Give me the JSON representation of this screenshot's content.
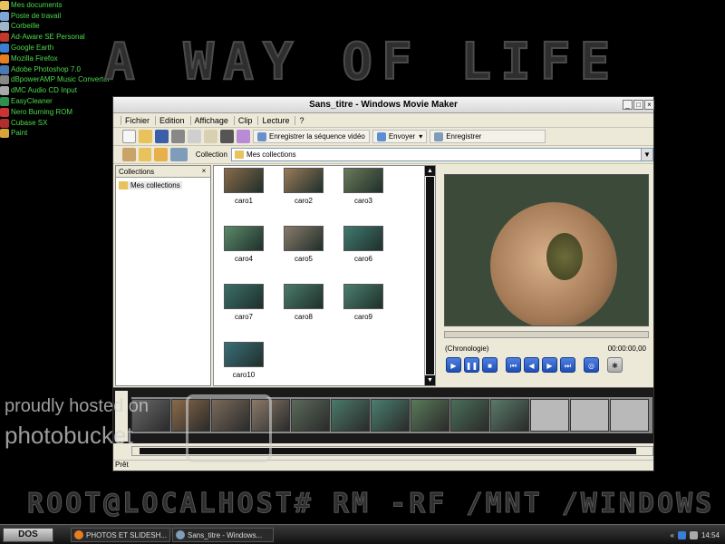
{
  "desktop": {
    "icons": [
      {
        "label": "Mes documents",
        "color": "#e8c25a"
      },
      {
        "label": "Poste de travail",
        "color": "#7fa6d6"
      },
      {
        "label": "Corbeille",
        "color": "#9fb5c9"
      },
      {
        "label": "Ad-Aware SE Personal",
        "color": "#c0392b"
      },
      {
        "label": "Google Earth",
        "color": "#3a7fd5"
      },
      {
        "label": "Mozilla Firefox",
        "color": "#e67e22"
      },
      {
        "label": "Adobe Photoshop 7.0",
        "color": "#4a7ab5"
      },
      {
        "label": "dBpowerAMP Music Converter",
        "color": "#888888"
      },
      {
        "label": "dMC Audio CD Input",
        "color": "#aaaaaa"
      },
      {
        "label": "EasyCleaner",
        "color": "#2f8f4f"
      },
      {
        "label": "Nero Burning ROM",
        "color": "#cc3333"
      },
      {
        "label": "Cubase SX",
        "color": "#b03030"
      },
      {
        "label": "Paint",
        "color": "#d9a53a"
      }
    ],
    "wallpaper_top": "A WAY OF LIFE",
    "wallpaper_bottom": "ROOT@LOCALHOST# RM -RF /MNT /WINDOWS"
  },
  "window": {
    "title": "Sans_titre - Windows Movie Maker",
    "controls": {
      "minimize": "_",
      "maximize": "□",
      "close": "×"
    },
    "menu": [
      "Fichier",
      "Edition",
      "Affichage",
      "Clip",
      "Lecture",
      "?"
    ],
    "toolbar": {
      "save_movie": "Enregistrer la séquence vidéo",
      "send": "Envoyer",
      "record": "Enregistrer"
    },
    "collection_bar": {
      "label": "Collection",
      "selected": "Mes collections"
    },
    "collections_pane": {
      "title": "Collections",
      "close": "×",
      "item": "Mes collections"
    },
    "clips": [
      "caro1",
      "caro2",
      "caro3",
      "caro4",
      "caro5",
      "caro6",
      "caro7",
      "caro8",
      "caro9",
      "caro10"
    ],
    "preview": {
      "label": "(Chronologie)",
      "timecode": "00:00:00,00"
    },
    "status": "Prêt"
  },
  "watermark": {
    "line1": "proudly hosted on",
    "line2": "photobucket"
  },
  "taskbar": {
    "start": "DOS",
    "tasks": [
      "PHOTOS ET SLIDESH...",
      "Sans_titre - Windows..."
    ],
    "chevron": "«",
    "clock": "14:54"
  }
}
